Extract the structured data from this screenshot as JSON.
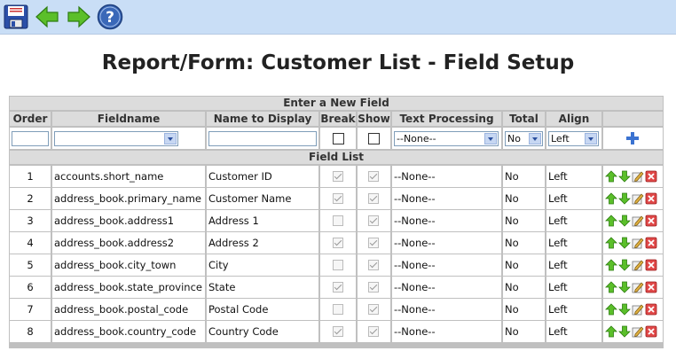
{
  "toolbar": {
    "save_icon": "save-icon",
    "back_icon": "arrow-left-icon",
    "forward_icon": "arrow-right-icon",
    "help_icon": "help-icon"
  },
  "page_title": "Report/Form: Customer List - Field Setup",
  "new_field": {
    "section_title": "Enter a New Field",
    "headers": [
      "Order",
      "Fieldname",
      "Name to Display",
      "Break",
      "Show",
      "Text Processing",
      "Total",
      "Align"
    ],
    "order_value": "",
    "fieldname_value": "",
    "display_value": "",
    "text_processing": "--None--",
    "total": "No",
    "align": "Left"
  },
  "field_list": {
    "section_title": "Field List",
    "rows": [
      {
        "order": "1",
        "fieldname": "accounts.short_name",
        "display": "Customer ID",
        "break": true,
        "show": true,
        "processing": "--None--",
        "total": "No",
        "align": "Left"
      },
      {
        "order": "2",
        "fieldname": "address_book.primary_name",
        "display": "Customer Name",
        "break": true,
        "show": true,
        "processing": "--None--",
        "total": "No",
        "align": "Left"
      },
      {
        "order": "3",
        "fieldname": "address_book.address1",
        "display": "Address 1",
        "break": false,
        "show": true,
        "processing": "--None--",
        "total": "No",
        "align": "Left"
      },
      {
        "order": "4",
        "fieldname": "address_book.address2",
        "display": "Address 2",
        "break": true,
        "show": true,
        "processing": "--None--",
        "total": "No",
        "align": "Left"
      },
      {
        "order": "5",
        "fieldname": "address_book.city_town",
        "display": "City",
        "break": false,
        "show": true,
        "processing": "--None--",
        "total": "No",
        "align": "Left"
      },
      {
        "order": "6",
        "fieldname": "address_book.state_province",
        "display": "State",
        "break": true,
        "show": true,
        "processing": "--None--",
        "total": "No",
        "align": "Left"
      },
      {
        "order": "7",
        "fieldname": "address_book.postal_code",
        "display": "Postal Code",
        "break": false,
        "show": true,
        "processing": "--None--",
        "total": "No",
        "align": "Left"
      },
      {
        "order": "8",
        "fieldname": "address_book.country_code",
        "display": "Country Code",
        "break": true,
        "show": true,
        "processing": "--None--",
        "total": "No",
        "align": "Left"
      }
    ]
  }
}
